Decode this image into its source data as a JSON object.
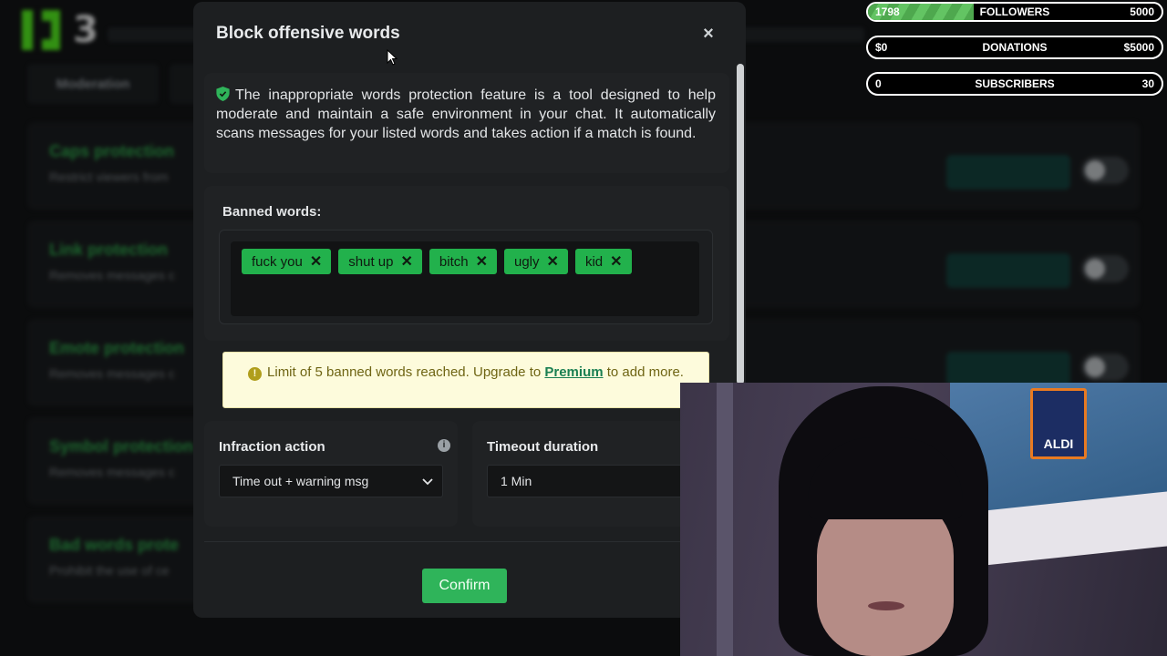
{
  "background": {
    "logo_number": "3",
    "tabs": [
      {
        "label": "Moderation"
      },
      {
        "label": ""
      }
    ],
    "rows": [
      {
        "title": "Caps protection",
        "desc": "Restrict viewers from"
      },
      {
        "title": "Link protection",
        "desc": "Removes messages c"
      },
      {
        "title": "Emote protection",
        "desc": "Removes messages c"
      },
      {
        "title": "Symbol protection",
        "desc": "Removes messages c"
      },
      {
        "title": "Bad words prote",
        "desc": "Prohibit the use of ce"
      }
    ]
  },
  "stats": {
    "followers": {
      "current": "1798",
      "label": "FOLLOWERS",
      "goal": "5000",
      "progress": 0.36
    },
    "donations": {
      "current": "$0",
      "label": "DONATIONS",
      "goal": "$5000"
    },
    "subscribers": {
      "current": "0",
      "label": "SUBSCRIBERS",
      "goal": "30"
    }
  },
  "modal": {
    "title": "Block offensive words",
    "close_glyph": "×",
    "info_text": "The inappropriate words protection feature is a tool designed to help moderate and maintain a safe environment in your chat. It automatically scans messages for your listed words and takes action if a match is found.",
    "banned_label": "Banned words:",
    "banned_words": [
      "fuck you",
      "shut up",
      "bitch",
      "ugly",
      "kid"
    ],
    "remove_glyph": "✕",
    "warning": {
      "before": "Limit of 5 banned words reached. Upgrade to",
      "link": "Premium",
      "after": "to add more."
    },
    "infraction": {
      "label": "Infraction action",
      "value": "Time out + warning msg"
    },
    "timeout": {
      "label": "Timeout duration",
      "value": "1 Min"
    },
    "confirm_label": "Confirm"
  },
  "webcam": {
    "poster_text": "ALDI"
  },
  "colors": {
    "accent": "#53fc18",
    "tag": "#22b14c",
    "confirm": "#2fb45a",
    "warning_bg": "#fdfbdc"
  }
}
